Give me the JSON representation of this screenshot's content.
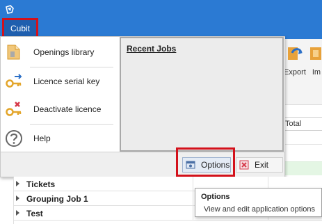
{
  "file_menu": {
    "tab_label": "Cubit"
  },
  "ribbon": {
    "buttons": [
      {
        "label": "Export",
        "icon": "export-icon"
      },
      {
        "label": "Im",
        "icon": "import-icon"
      }
    ]
  },
  "grid": {
    "total_header": "Total"
  },
  "backstage": {
    "items": [
      {
        "label": "Openings library",
        "icon": "openings-library-icon"
      },
      {
        "label": "Licence serial key",
        "icon": "key-icon"
      },
      {
        "label": "Deactivate licence",
        "icon": "deactivate-key-icon"
      },
      {
        "label": "Help",
        "icon": "help-icon"
      }
    ],
    "recent_jobs_title": "Recent Jobs",
    "options_label": "Options",
    "exit_label": "Exit"
  },
  "tree": {
    "rows": [
      {
        "label": "Tickets"
      },
      {
        "label": "Grouping Job 1"
      },
      {
        "label": "Test"
      }
    ]
  },
  "tooltip": {
    "title": "Options",
    "description": "View and edit application options"
  },
  "colors": {
    "title_bar": "#2b7ad3",
    "highlight": "#d3111b",
    "file_tab": "#1f5fae"
  }
}
